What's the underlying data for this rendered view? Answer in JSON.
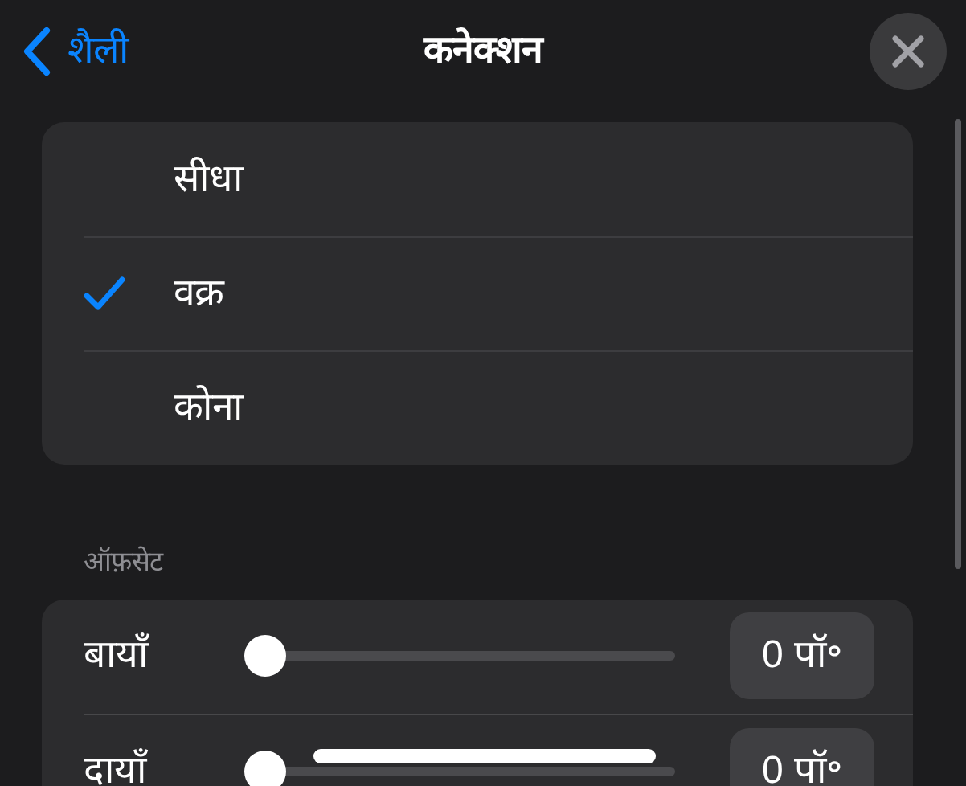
{
  "nav": {
    "back": "शैली",
    "title": "कनेक्शन"
  },
  "styles": [
    {
      "label": "सीधा",
      "selected": false
    },
    {
      "label": "वक्र",
      "selected": true
    },
    {
      "label": "कोना",
      "selected": false
    }
  ],
  "offset": {
    "heading": "ऑफ़सेट",
    "rows": [
      {
        "label": "बायाँ",
        "level": 0,
        "value": "0 पॉ॰"
      },
      {
        "label": "दायाँ",
        "level": 0,
        "value": "0 पॉ॰"
      }
    ]
  }
}
